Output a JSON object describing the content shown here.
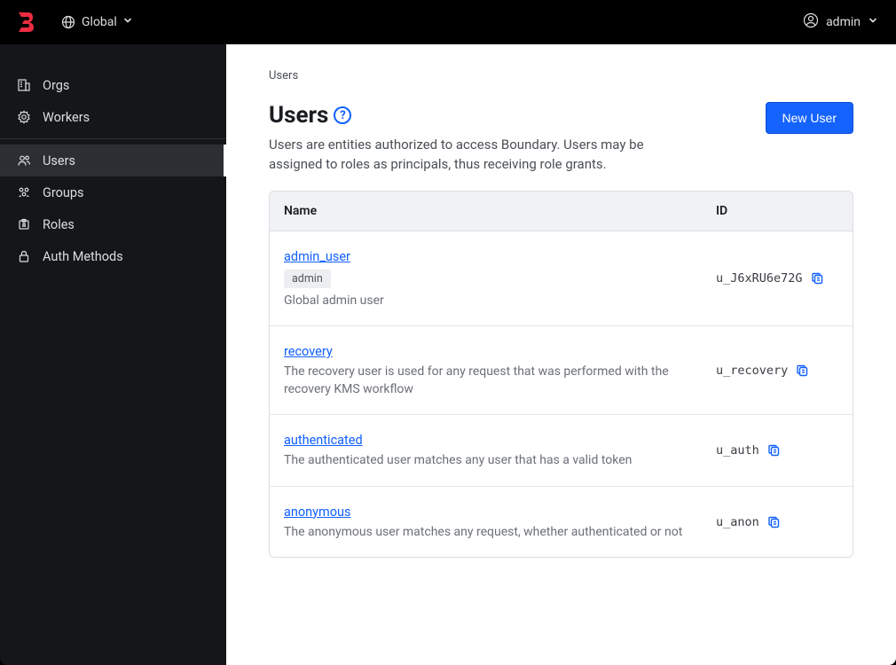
{
  "topbar": {
    "scope_label": "Global",
    "user_label": "admin"
  },
  "sidebar": {
    "items": [
      {
        "label": "Orgs",
        "icon": "org-icon",
        "active": false
      },
      {
        "label": "Workers",
        "icon": "workers-icon",
        "active": false
      },
      {
        "label": "Users",
        "icon": "users-icon",
        "active": true
      },
      {
        "label": "Groups",
        "icon": "groups-icon",
        "active": false
      },
      {
        "label": "Roles",
        "icon": "roles-icon",
        "active": false
      },
      {
        "label": "Auth Methods",
        "icon": "lock-icon",
        "active": false
      }
    ]
  },
  "breadcrumb": "Users",
  "page": {
    "title": "Users",
    "description": "Users are entities authorized to access Boundary. Users may be assigned to roles as principals, thus receiving role grants.",
    "new_button": "New User"
  },
  "table": {
    "columns": {
      "name": "Name",
      "id": "ID"
    },
    "rows": [
      {
        "name": "admin_user",
        "badge": "admin",
        "description": "Global admin user",
        "id": "u_J6xRU6e72G"
      },
      {
        "name": "recovery",
        "badge": null,
        "description": "The recovery user is used for any request that was performed with the recovery KMS workflow",
        "id": "u_recovery"
      },
      {
        "name": "authenticated",
        "badge": null,
        "description": "The authenticated user matches any user that has a valid token",
        "id": "u_auth"
      },
      {
        "name": "anonymous",
        "badge": null,
        "description": "The anonymous user matches any request, whether authenticated or not",
        "id": "u_anon"
      }
    ]
  }
}
